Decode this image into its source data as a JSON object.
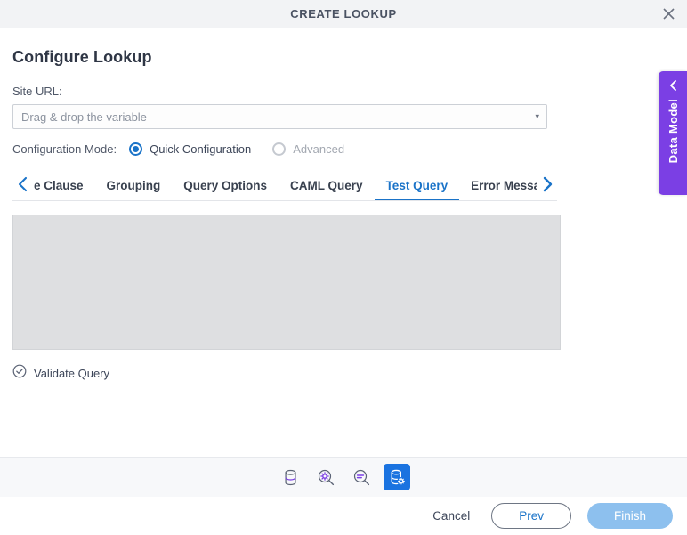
{
  "window": {
    "title": "CREATE LOOKUP",
    "close_icon": "close-icon"
  },
  "content": {
    "page_title": "Configure Lookup",
    "site_url": {
      "label": "Site URL:",
      "placeholder": "Drag & drop the variable",
      "value": "",
      "caret": "▾"
    },
    "configuration_mode": {
      "label": "Configuration Mode:",
      "options": [
        {
          "label": "Quick Configuration",
          "selected": true,
          "disabled": false
        },
        {
          "label": "Advanced",
          "selected": false,
          "disabled": true
        }
      ]
    },
    "tabs": {
      "prev_arrow": "chevron-left-icon",
      "next_arrow": "chevron-right-icon",
      "items": [
        {
          "label": "e Clause",
          "active": false
        },
        {
          "label": "Grouping",
          "active": false
        },
        {
          "label": "Query Options",
          "active": false
        },
        {
          "label": "CAML Query",
          "active": false
        },
        {
          "label": "Test Query",
          "active": true
        },
        {
          "label": "Error Messages",
          "active": false
        }
      ]
    },
    "result_panel": {
      "content": ""
    },
    "validate": {
      "label": "Validate Query",
      "icon": "check-circle-icon"
    }
  },
  "icon_toolbar": {
    "items": [
      {
        "name": "database-icon",
        "selected": false
      },
      {
        "name": "search-settings-icon",
        "selected": false
      },
      {
        "name": "search-query-icon",
        "selected": false
      },
      {
        "name": "database-settings-icon",
        "selected": true
      }
    ]
  },
  "footer": {
    "cancel_label": "Cancel",
    "prev_label": "Prev",
    "finish_label": "Finish"
  },
  "side_tab": {
    "label": "Data Model",
    "chevron": "chevron-left-icon"
  },
  "colors": {
    "accent_blue": "#1a73c8",
    "selected_icon_bg": "#1a73e0",
    "purple": "#7b3fe4",
    "icon_purple": "#7b3fe4",
    "finish_bg": "#8dc0ee",
    "panel_grey": "#dedfe1",
    "titlebar_bg": "#f2f3f5"
  }
}
